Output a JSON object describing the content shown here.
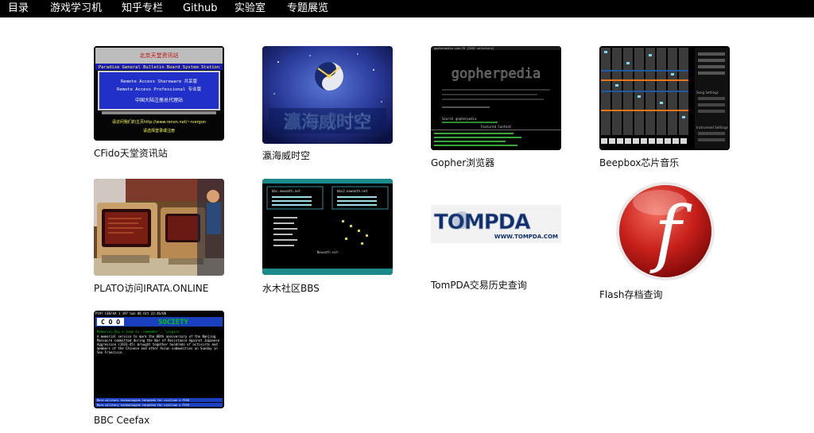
{
  "nav": {
    "items": [
      {
        "label": "目录"
      },
      {
        "label": "游戏学习机"
      },
      {
        "label": "知乎专栏"
      },
      {
        "label": "Github"
      },
      {
        "label": "实验室"
      },
      {
        "label": "专题展览"
      }
    ]
  },
  "colors": {
    "nav_bg": "#000000",
    "page_bg": "#ffffff",
    "bbs_blue": "#1a3fbf",
    "flash_red": "#c8201a",
    "ceefax_green": "#00c800"
  },
  "cards": [
    {
      "caption": "CFido天堂资讯站",
      "icon": "cfido-bbs-thumbnail",
      "thumb": {
        "header": "北京天堂资讯站",
        "banner": "Paradise General Bulletin Board System Station",
        "line1": "Remote Access Shareware  共享版",
        "line2": "Remote Access Professional 专业版",
        "line3": "中国大陆注册总代理站",
        "footer1": "请访问我们的主页http://www.renxn.net/~rvergon",
        "footer2": "请选择登录或注册"
      }
    },
    {
      "caption": "瀛海威时空",
      "icon": "yinghaiwei-logo-thumbnail",
      "thumb": {
        "title": "瀛海威时空"
      }
    },
    {
      "caption": "Gopher浏览器",
      "icon": "gopher-terminal-thumbnail",
      "thumb": {
        "header": "gopherpedia.com:70 [2502 selectors]",
        "logo": "gopherpedia",
        "search": "Search gopherpedia",
        "featured": "Featured Content"
      }
    },
    {
      "caption": "Beepbox芯片音乐",
      "icon": "beepbox-sequencer-thumbnail",
      "thumb": {
        "panel1": "Song Settings",
        "panel2": "Instrument Settings"
      }
    },
    {
      "caption": "PLATO访问IRATA.ONLINE",
      "icon": "plato-terminal-photo-thumbnail",
      "thumb": {}
    },
    {
      "caption": "水木社区BBS",
      "icon": "newsmth-bbs-thumbnail",
      "thumb": {
        "left": "bbs.newsmth.net",
        "right": "bbs2.newsmth.net",
        "bottom": "Newsmth.net"
      }
    },
    {
      "caption": "TomPDA交易历史查询",
      "icon": "tompda-logo",
      "thumb": {
        "logo": "TOMPDA",
        "url": "WWW.TOMPDA.COM"
      }
    },
    {
      "caption": "Flash存档查询",
      "icon": "flash-player-logo",
      "thumb": {
        "glyph": "f"
      }
    },
    {
      "caption": "BBC Ceefax",
      "icon": "ceefax-teletext-thumbnail",
      "thumb": {
        "header": "P197  CEEFAX 1 197 Sun 06 Oct   22:46/06",
        "logo": "C O O",
        "section": "SOCIETY",
        "headline": "Memorial Day a time to 'remember', 'inspire'",
        "body": "A memorial service to mark the 80th anniversary of the Nanjing Massacre committed during the War of Resistance Against Japanese Aggression (1931-45) brought together hundreds of activists and members of the Chinese and other Asian communities on Sunday in San Francisco.",
        "foot1": "More military technologies targeted for civilian u   P198",
        "foot2": "More military technologies targeted for civilian u   P199"
      }
    }
  ]
}
